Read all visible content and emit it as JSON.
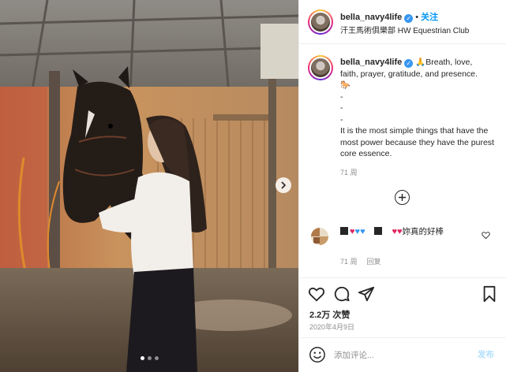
{
  "post": {
    "username": "bella_navy4life",
    "verified": true,
    "follow_label": "关注",
    "location": "汗王馬術俱樂部 HW Equestrian Club",
    "images_count": 3,
    "active_image": 1
  },
  "caption": {
    "username": "bella_navy4life",
    "text_first": "Breath, love,",
    "text_line2": "faith, prayer, gratitude, and presence.",
    "separators": [
      "-",
      "-",
      "-"
    ],
    "text_body": "It is the most simple things that have the most power because they have the purest core essence.",
    "time": "71 周"
  },
  "comment": {
    "text": "妳真的好棒",
    "time": "71 周",
    "reply_label": "回复"
  },
  "stats": {
    "likes": "2.2万 次赞",
    "date": "2020年4月9日"
  },
  "add_comment": {
    "placeholder": "添加评论...",
    "post_label": "发布"
  },
  "icons": {
    "verified": "verified-badge-icon",
    "praying_hands": "praying-hands-emoji",
    "horse": "horse-emoji",
    "load_more": "plus-circle-icon",
    "like": "heart-icon",
    "comment": "comment-bubble-icon",
    "share": "paper-plane-icon",
    "save": "bookmark-icon",
    "emoji": "smiley-icon",
    "next": "chevron-right-icon"
  },
  "colors": {
    "accent": "#0095f6",
    "verified": "#3897f0",
    "text": "#262626",
    "muted": "#8e8e8e",
    "heart": "#e0245e"
  }
}
